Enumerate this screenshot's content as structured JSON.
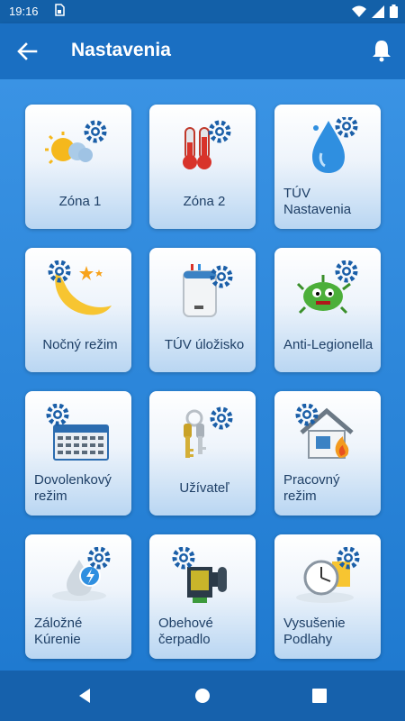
{
  "status_bar": {
    "time": "19:16"
  },
  "app_bar": {
    "title": "Nastavenia"
  },
  "tiles": [
    {
      "label": "Zóna 1"
    },
    {
      "label": "Zóna 2"
    },
    {
      "label": "TÚV Nastavenia"
    },
    {
      "label": "Nočný režim"
    },
    {
      "label": "TÚV úložisko"
    },
    {
      "label": "Anti-Legionella"
    },
    {
      "label": "Dovolenkový režim"
    },
    {
      "label": "Užívateľ"
    },
    {
      "label": "Pracovný režim"
    },
    {
      "label": "Záložné Kúrenie"
    },
    {
      "label": "Obehové čerpadlo"
    },
    {
      "label": "Vysušenie Podlahy"
    }
  ],
  "colors": {
    "accent": "#1a6fc2",
    "gear": "#1b5fa8",
    "text": "#1e3f66"
  }
}
